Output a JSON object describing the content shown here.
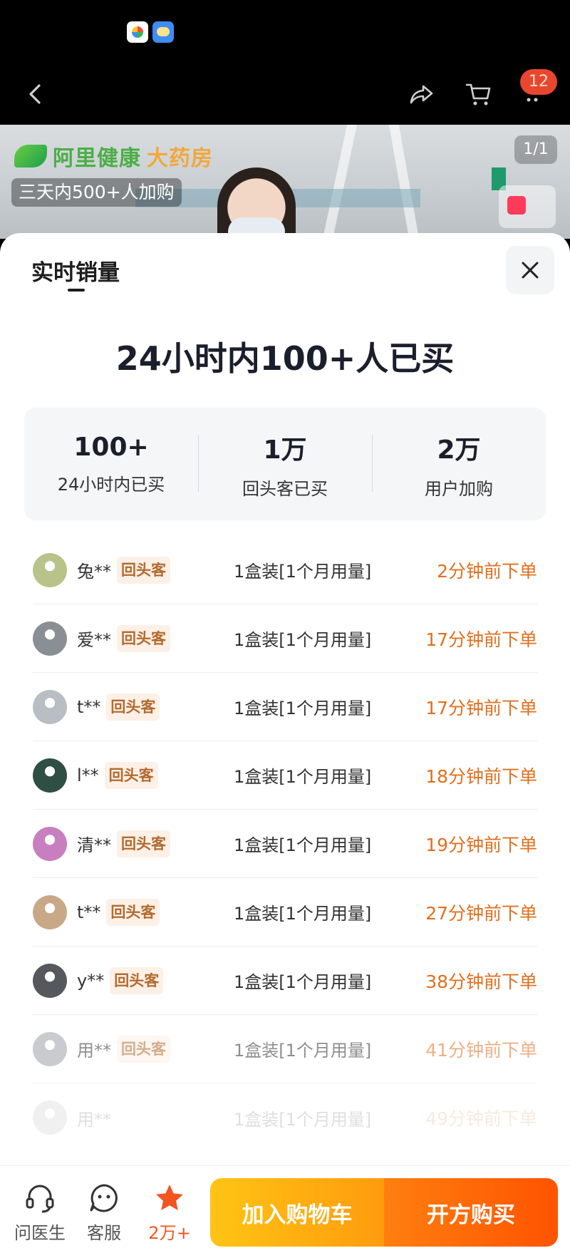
{
  "header": {
    "cart_count": "12"
  },
  "hero": {
    "logo_text_green": "阿里健康",
    "logo_text_yellow": "大药房",
    "image_counter": "1/1",
    "promo_text": "三天内500+人加购"
  },
  "sheet": {
    "title": "实时销量",
    "headline": "24小时内100+人已买",
    "stats": [
      {
        "value": "100+",
        "label": "24小时内已买"
      },
      {
        "value": "1万",
        "label": "回头客已买"
      },
      {
        "value": "2万",
        "label": "用户加购"
      }
    ],
    "orders": [
      {
        "user": "兔**",
        "tag": "回头客",
        "spec": "1盒装[1个月用量]",
        "time": "2分钟前下单",
        "avatar_color": "#b8c38a"
      },
      {
        "user": "爱**",
        "tag": "回头客",
        "spec": "1盒装[1个月用量]",
        "time": "17分钟前下单",
        "avatar_color": "#8a8f96"
      },
      {
        "user": "t**",
        "tag": "回头客",
        "spec": "1盒装[1个月用量]",
        "time": "17分钟前下单",
        "avatar_color": "#b9bec4"
      },
      {
        "user": "l**",
        "tag": "回头客",
        "spec": "1盒装[1个月用量]",
        "time": "18分钟前下单",
        "avatar_color": "#2f4f45"
      },
      {
        "user": "清**",
        "tag": "回头客",
        "spec": "1盒装[1个月用量]",
        "time": "19分钟前下单",
        "avatar_color": "#c77fbf"
      },
      {
        "user": "t**",
        "tag": "回头客",
        "spec": "1盒装[1个月用量]",
        "time": "27分钟前下单",
        "avatar_color": "#c9a887"
      },
      {
        "user": "y**",
        "tag": "回头客",
        "spec": "1盒装[1个月用量]",
        "time": "38分钟前下单",
        "avatar_color": "#55585c"
      },
      {
        "user": "用**",
        "tag": "回头客",
        "spec": "1盒装[1个月用量]",
        "time": "41分钟前下单",
        "avatar_color": "#9ea2a8"
      },
      {
        "user": "用**",
        "tag": "",
        "spec": "1盒装[1个月用量]",
        "time": "49分钟前下单",
        "avatar_color": "#9ea2a8"
      }
    ]
  },
  "bottom_bar": {
    "ask_doctor": "问医生",
    "customer_service": "客服",
    "favorites_count": "2万+",
    "add_to_cart": "加入购物车",
    "prescription_buy": "开方购买"
  },
  "colors": {
    "accent_orange": "#e0701e",
    "returning_tag_bg": "#fdf0e6",
    "cart_button": "#ffc414",
    "buy_button": "#ff5300"
  },
  "icons": [
    "back-icon",
    "share-icon",
    "cart-icon",
    "more-icon",
    "close-icon",
    "headset-icon",
    "service-face-icon",
    "star-icon"
  ]
}
